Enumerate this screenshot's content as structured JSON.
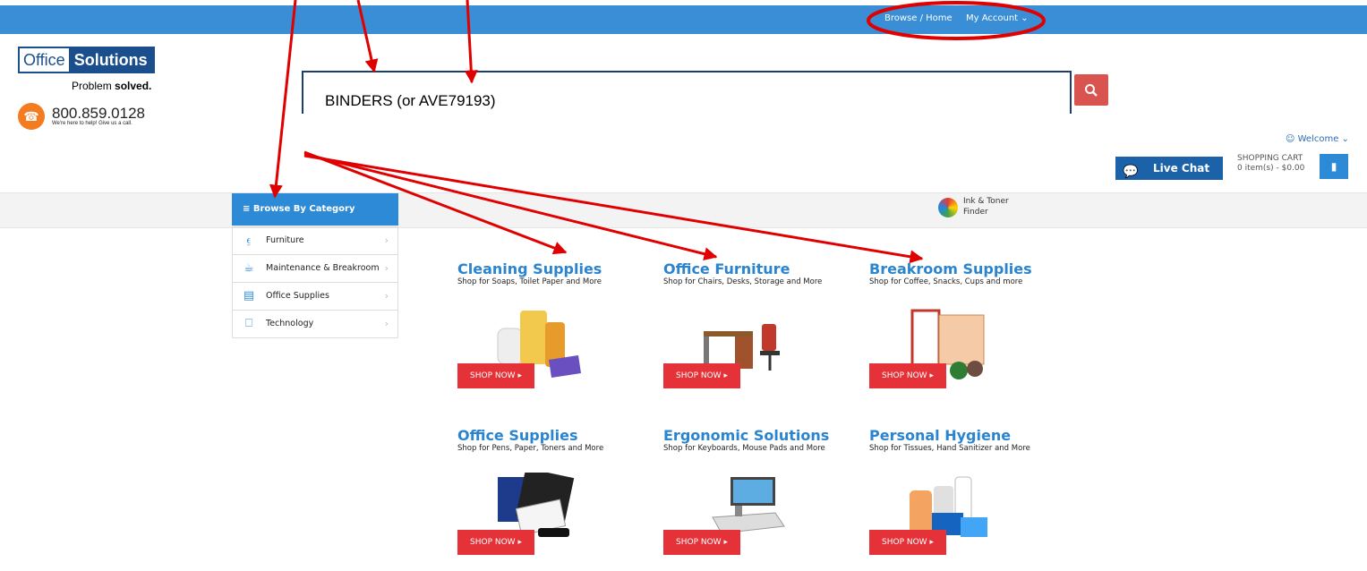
{
  "topbar": {
    "browse_home": "Browse / Home",
    "my_account": "My Account ⌄"
  },
  "logo": {
    "word1": "Office",
    "word2": "Solutions",
    "tagline_a": "Problem ",
    "tagline_b": "solved.",
    "phone": "800.859.0128",
    "phone_note": "We're here to help! Give us a call."
  },
  "search": {
    "value": "BINDERS (or AVE79193)",
    "button_icon": "search-icon"
  },
  "header": {
    "welcome": "☺ Welcome ⌄",
    "live_chat": "Live Chat",
    "cart_label": "SHOPPING CART",
    "cart_summary": "0 item(s) - $0.00"
  },
  "browse": {
    "heading": "≡  Browse By Category",
    "items": [
      {
        "label": "Furniture",
        "icon": "chair-icon"
      },
      {
        "label": "Maintenance & Breakroom",
        "icon": "coffee-icon"
      },
      {
        "label": "Office Supplies",
        "icon": "office-supplies-icon"
      },
      {
        "label": "Technology",
        "icon": "monitor-icon"
      }
    ]
  },
  "ink": {
    "line1": "Ink & Toner",
    "line2": "Finder"
  },
  "promos": [
    {
      "title": "Cleaning Supplies",
      "subtitle": "Shop for Soaps, Toilet Paper and More",
      "button": "SHOP NOW ▸"
    },
    {
      "title": "Office Furniture",
      "subtitle": "Shop for Chairs, Desks, Storage and More",
      "button": "SHOP NOW ▸"
    },
    {
      "title": "Breakroom Supplies",
      "subtitle": "Shop for Coffee, Snacks, Cups and more",
      "button": "SHOP NOW ▸"
    },
    {
      "title": "Office Supplies",
      "subtitle": "Shop for Pens, Paper, Toners and More",
      "button": "SHOP NOW ▸"
    },
    {
      "title": "Ergonomic Solutions",
      "subtitle": "Shop for Keyboards, Mouse Pads and More",
      "button": "SHOP NOW ▸"
    },
    {
      "title": "Personal Hygiene",
      "subtitle": "Shop for Tissues, Hand Sanitizer and More",
      "button": "SHOP NOW ▸"
    }
  ],
  "colors": {
    "topbar": "#3a8ed6",
    "accent_blue": "#2a84d0",
    "shop_red": "#e53238",
    "annotation_red": "#e00000"
  }
}
